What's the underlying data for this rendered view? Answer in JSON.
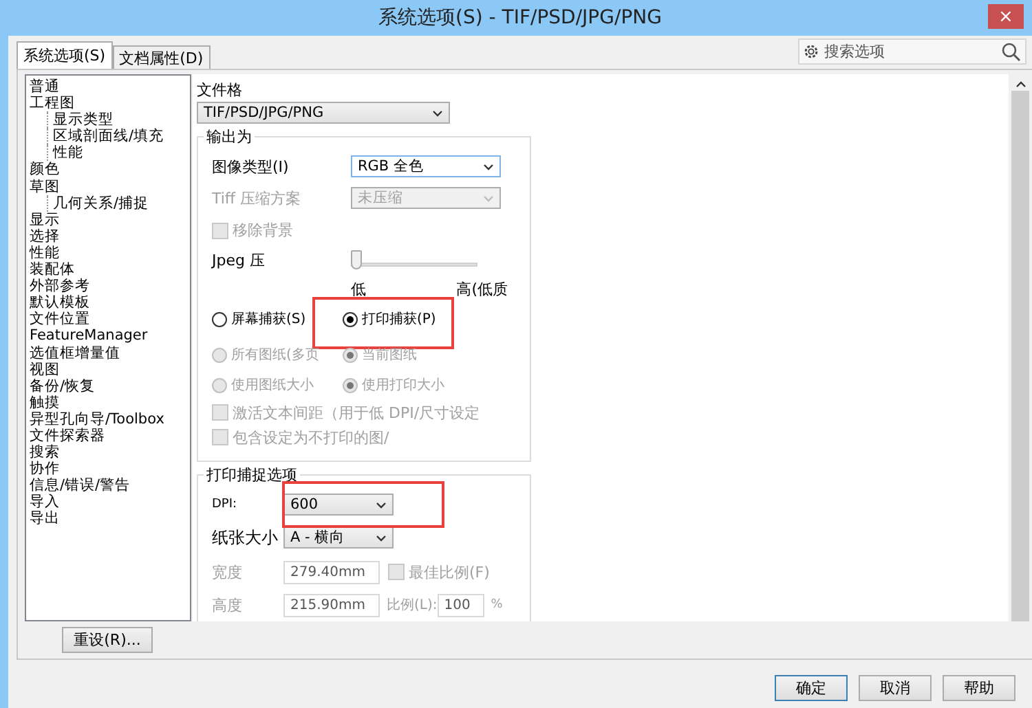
{
  "window": {
    "title": "系统选项(S) - TIF/PSD/JPG/PNG",
    "close": "×"
  },
  "search": {
    "placeholder": "搜索选项"
  },
  "tabs": [
    {
      "label": "系统选项(S)",
      "selected": true
    },
    {
      "label": "文档属性(D)",
      "selected": false
    }
  ],
  "tree": [
    {
      "label": "普通"
    },
    {
      "label": "工程图",
      "children": [
        {
          "label": "显示类型"
        },
        {
          "label": "区域剖面线/填充"
        },
        {
          "label": "性能"
        }
      ]
    },
    {
      "label": "颜色"
    },
    {
      "label": "草图",
      "children": [
        {
          "label": "几何关系/捕捉"
        }
      ]
    },
    {
      "label": "显示"
    },
    {
      "label": "选择"
    },
    {
      "label": "性能"
    },
    {
      "label": "装配体"
    },
    {
      "label": "外部参考"
    },
    {
      "label": "默认模板"
    },
    {
      "label": "文件位置"
    },
    {
      "label": "FeatureManager"
    },
    {
      "label": "选值框增量值"
    },
    {
      "label": "视图"
    },
    {
      "label": "备份/恢复"
    },
    {
      "label": "触摸"
    },
    {
      "label": "异型孔向导/Toolbox"
    },
    {
      "label": "文件探索器"
    },
    {
      "label": "搜索"
    },
    {
      "label": "协作"
    },
    {
      "label": "信息/错误/警告"
    },
    {
      "label": "导入"
    },
    {
      "label": "导出"
    }
  ],
  "reset_button": "重设(R)...",
  "file_format": {
    "label": "文件格",
    "value": "TIF/PSD/JPG/PNG"
  },
  "output_group": {
    "title": "输出为",
    "image_type": {
      "label": "图像类型(I)",
      "value": "RGB 全色"
    },
    "tiff_compression": {
      "label": "Tiff 压缩方案",
      "value": "未压缩",
      "disabled": true
    },
    "remove_background": {
      "label": "移除背景",
      "checked": false,
      "disabled": true
    },
    "jpeg": {
      "label": "Jpeg 压",
      "level": 0,
      "low": "低",
      "high": "高(低质"
    },
    "radio_rows": [
      [
        {
          "label": "屏幕捕获(S)",
          "selected": false,
          "disabled": false
        },
        {
          "label": "打印捕获(P)",
          "selected": true,
          "disabled": false,
          "highlighted": true
        }
      ],
      [
        {
          "label": "所有图纸(多页",
          "selected": false,
          "disabled": true
        },
        {
          "label": "当前图纸",
          "selected": true,
          "disabled": true
        }
      ],
      [
        {
          "label": "使用图纸大小",
          "selected": false,
          "disabled": true
        },
        {
          "label": "使用打印大小",
          "selected": true,
          "disabled": true
        }
      ]
    ],
    "checkboxes": [
      {
        "label": "激活文本间距（用于低 DPI/尺寸设定",
        "checked": false,
        "disabled": true
      },
      {
        "label": "包含设定为不打印的图/",
        "checked": false,
        "disabled": true
      }
    ]
  },
  "print_group": {
    "title": "打印捕捉选项",
    "dpi": {
      "label": "DPI:",
      "value": "600",
      "highlighted": true
    },
    "paper_size": {
      "label": "纸张大小",
      "value": "A - 横向"
    },
    "width": {
      "label": "宽度",
      "value": "279.40mm",
      "disabled": true
    },
    "best_scale": {
      "label": "最佳比例(F)",
      "checked": false,
      "disabled": true
    },
    "height": {
      "label": "高度",
      "value": "215.90mm",
      "disabled": true
    },
    "scale": {
      "label": "比例(L):",
      "value": "100",
      "unit": "%",
      "disabled": true
    }
  },
  "buttons": [
    {
      "label": "确定",
      "default": true
    },
    {
      "label": "取消",
      "default": false
    },
    {
      "label": "帮助",
      "default": false
    }
  ]
}
